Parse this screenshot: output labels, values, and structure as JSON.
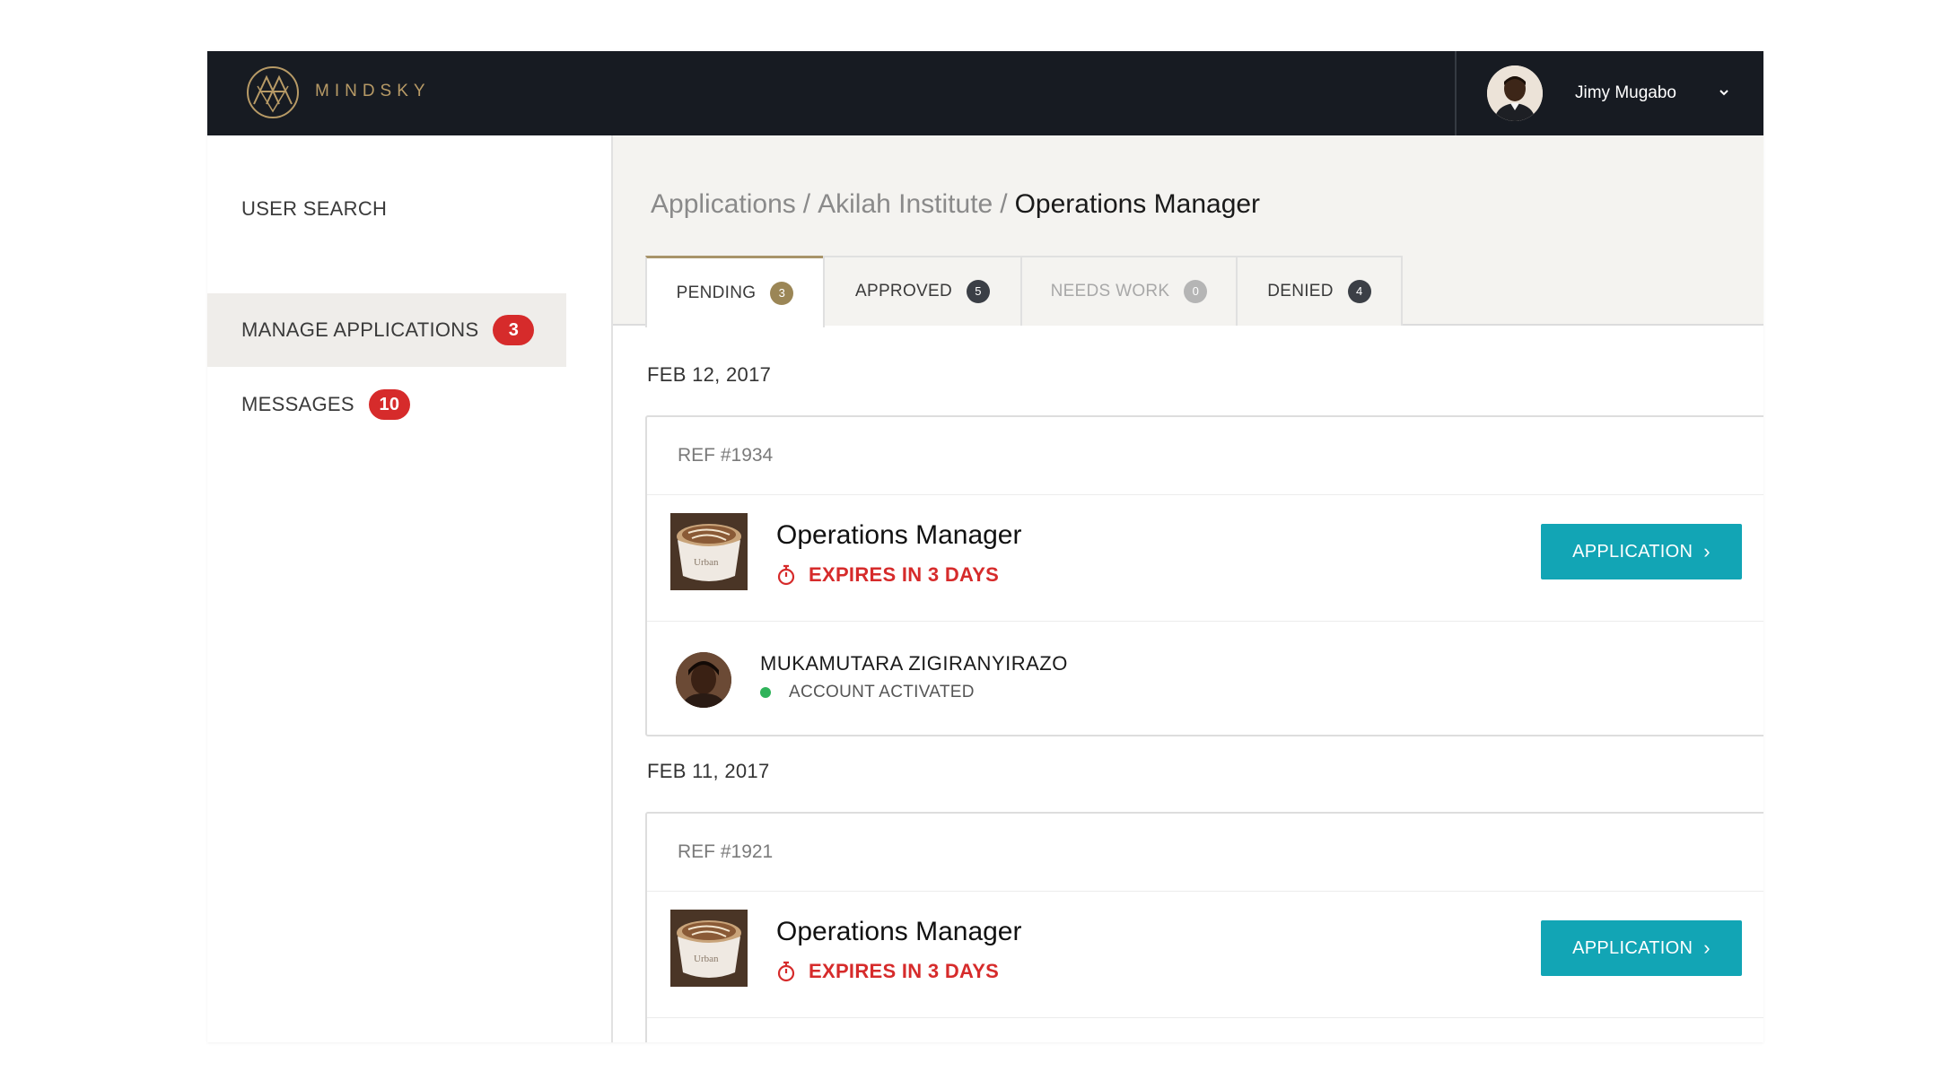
{
  "app": {
    "logo_text": "MINDSKY",
    "brand_color": "#b79a66",
    "accent_color": "#12a5b5",
    "alert_color": "#d62b2b"
  },
  "user": {
    "name": "Jimy Mugabo",
    "menu_icon": "chevron-down-icon"
  },
  "sidebar": {
    "items": [
      {
        "label": "USER SEARCH",
        "badge": null
      },
      {
        "label": "MANAGE APPLICATIONS",
        "badge": "3"
      },
      {
        "label": "MESSAGES",
        "badge": "10"
      }
    ]
  },
  "breadcrumb": {
    "parts": [
      "Applications",
      "Akilah Institute"
    ],
    "separator": "/",
    "current": "Operations Manager"
  },
  "tabs": [
    {
      "label": "PENDING",
      "count": "3",
      "color": "#9b8656"
    },
    {
      "label": "APPROVED",
      "count": "5",
      "color": "#3b3f46"
    },
    {
      "label": "NEEDS WORK",
      "count": "0",
      "color": "#b5b5b5"
    },
    {
      "label": "DENIED",
      "count": "4",
      "color": "#3b3f46"
    }
  ],
  "groups": [
    {
      "date": "FEB 12, 2017",
      "ref": "REF #1934",
      "job_title": "Operations Manager",
      "expires": "EXPIRES IN 3 DAYS",
      "button": "APPLICATION",
      "thumb_text": "Urban",
      "applicant": {
        "name": "MUKAMUTARA ZIGIRANYIRAZO",
        "status": "ACCOUNT ACTIVATED",
        "status_color": "#2fb35a"
      }
    },
    {
      "date": "FEB 11, 2017",
      "ref": "REF #1921",
      "job_title": "Operations Manager",
      "expires": "EXPIRES IN 3 DAYS",
      "button": "APPLICATION",
      "thumb_text": "Urban"
    }
  ]
}
